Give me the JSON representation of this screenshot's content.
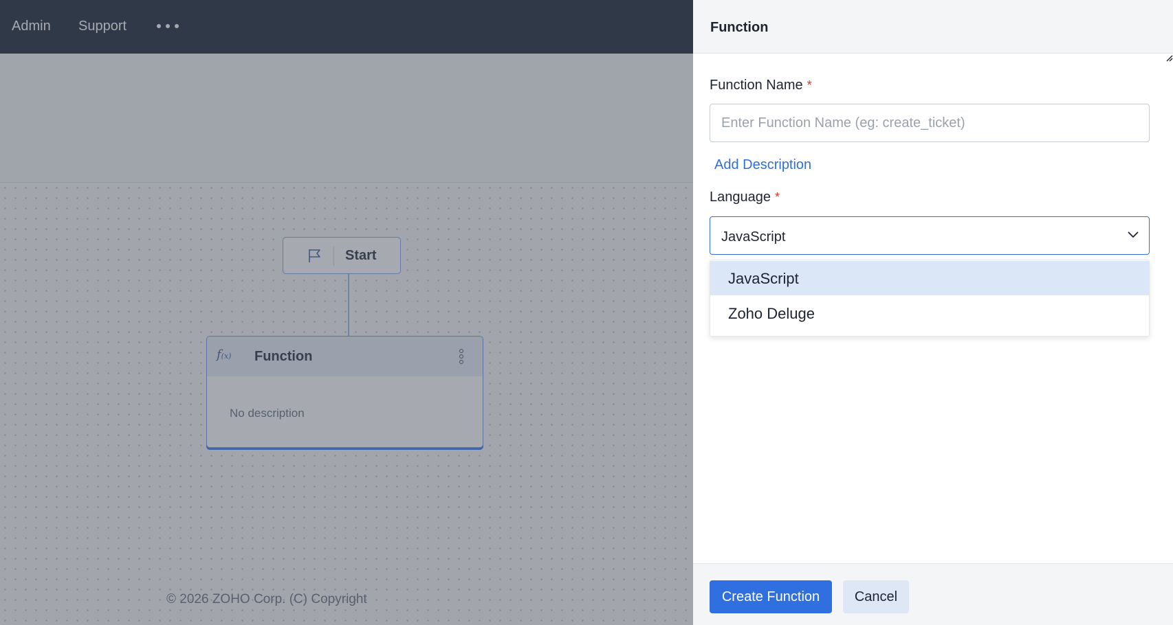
{
  "nav": {
    "items": [
      "Admin",
      "Support"
    ],
    "more_icon": "more-dots-icon"
  },
  "canvas": {
    "start_label": "Start",
    "start_icon": "flag-icon",
    "function_node": {
      "icon": "function-fx-icon",
      "icon_text": "f",
      "icon_sub": "(x)",
      "title": "Function",
      "description": "No description",
      "menu_icon": "kebab-menu-icon"
    },
    "copyright": "© 2026 ZOHO Corp. (C) Copyright"
  },
  "panel": {
    "title": "Function",
    "function_name": {
      "label": "Function Name",
      "required_mark": "*",
      "placeholder": "Enter Function Name (eg: create_ticket)",
      "value": ""
    },
    "add_description": "Add Description",
    "language": {
      "label": "Language",
      "required_mark": "*",
      "selected": "JavaScript",
      "options": [
        "JavaScript",
        "Zoho Deluge"
      ],
      "highlighted_option": "JavaScript"
    },
    "buttons": {
      "create": "Create Function",
      "cancel": "Cancel"
    }
  },
  "colors": {
    "accent": "#2f6fe0",
    "link": "#2f6fd6",
    "required": "#d9342b",
    "nav_bg": "#1e2a3b"
  }
}
